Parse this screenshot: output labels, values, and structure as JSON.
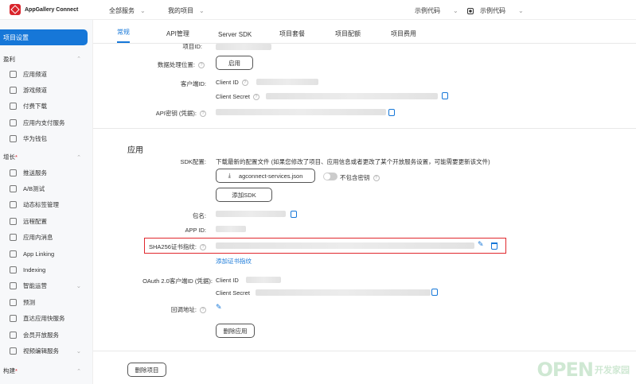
{
  "header": {
    "logo_text": "AppGallery Connect",
    "nav": [
      {
        "label": "全部服务"
      },
      {
        "label": "我的项目"
      }
    ],
    "right": [
      {
        "label": "示例代码"
      },
      {
        "label": "示例代码"
      }
    ]
  },
  "sidebar": {
    "active": "项目设置",
    "groups": [
      {
        "label": "盈利",
        "required": false,
        "items": [
          "应用频道",
          "游戏频道",
          "付费下载",
          "应用内支付服务",
          "华为钱包"
        ]
      },
      {
        "label": "增长",
        "required": true,
        "items": [
          "推送服务",
          "A/B测试",
          "动态标签管理",
          "远程配置",
          "应用内消息",
          "App Linking",
          "Indexing",
          "智能运营",
          "预测",
          "直达应用快服务",
          "会员开放服务",
          "视频编辑服务"
        ]
      },
      {
        "label": "构建",
        "required": true,
        "items": []
      }
    ]
  },
  "tabs": [
    "常规",
    "API管理",
    "Server SDK",
    "项目套餐",
    "项目配额",
    "项目费用"
  ],
  "project": {
    "project_id_label": "项目ID:",
    "data_location_label": "数据处理位置:",
    "data_location_button": "启用",
    "client_id_label": "客户端ID:",
    "client_id_key": "Client ID",
    "client_secret_key": "Client Secret",
    "api_key_label": "API密钥 (凭据):"
  },
  "app": {
    "section_title": "应用",
    "sdk_label": "SDK配置:",
    "sdk_desc": "下载最新的配置文件 (如果您修改了项目、应用信息或者更改了某个开放服务设置，可能需要更新该文件)",
    "download_file": "agconnect-services.json",
    "toggle_label": "不包含密钥",
    "add_sdk_button": "添加SDK",
    "package_label": "包名:",
    "app_id_label": "APP ID:",
    "sha256_label": "SHA256证书指纹:",
    "add_cert_link": "添加证书指纹",
    "oauth_label": "OAuth 2.0客户端ID (凭据):",
    "oauth_client_id": "Client ID",
    "oauth_client_secret": "Client Secret",
    "callback_label": "回调地址:",
    "delete_app_button": "删除应用",
    "delete_project_button": "删除项目"
  },
  "watermark": {
    "big": "OPEN",
    "small": "开发家园"
  },
  "colors": {
    "accent": "#1677d8",
    "highlight": "#e0282e",
    "brand": "#d9252c"
  }
}
